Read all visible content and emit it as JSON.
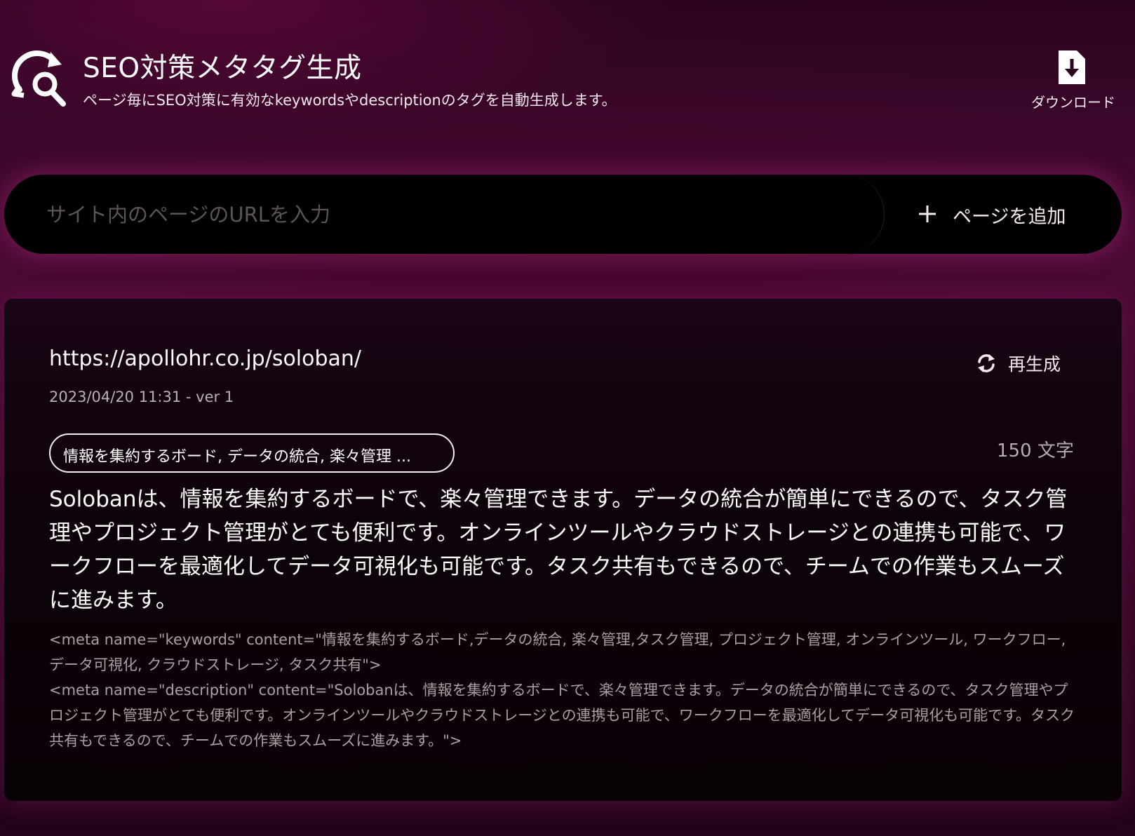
{
  "header": {
    "title": "SEO対策メタタグ生成",
    "subtitle": "ページ毎にSEO対策に有効なkeywordsやdescriptionのタグを自動生成します。",
    "logo_icon": "search-sync-icon",
    "download": {
      "label": "ダウンロード",
      "icon": "file-download-icon"
    }
  },
  "url_bar": {
    "placeholder": "サイト内のページのURLを入力",
    "value": "",
    "add_button": {
      "label": "ページを追加",
      "icon": "plus-icon"
    }
  },
  "card": {
    "url": "https://apollohr.co.jp/soloban/",
    "meta": "2023/04/20 11:31 - ver 1",
    "regenerate": {
      "label": "再生成",
      "icon": "refresh-icon"
    },
    "keywords_pill": "情報を集約するボード, データの統合, 楽々管理 ...",
    "char_count": "150 文字",
    "description": "Solobanは、情報を集約するボードで、楽々管理できます。データの統合が簡単にできるので、タスク管理やプロジェクト管理がとても便利です。オンラインツールやクラウドストレージとの連携も可能で、ワークフローを最適化してデータ可視化も可能です。タスク共有もできるので、チームでの作業もスムーズに進みます。",
    "meta_keywords_tag": "<meta name=\"keywords\" content=\"情報を集約するボード,データの統合, 楽々管理,タスク管理, プロジェクト管理, オンラインツール, ワークフロー, データ可視化, クラウドストレージ, タスク共有\">",
    "meta_description_tag": "<meta name=\"description\" content=\"Solobanは、情報を集約するボードで、楽々管理できます。データの統合が簡単にできるので、タスク管理やプロジェクト管理がとても便利です。オンラインツールやクラウドストレージとの連携も可能で、ワークフローを最適化してデータ可視化も可能です。タスク共有もできるので、チームでの作業もスムーズに進みます。\">"
  },
  "colors": {
    "background_top": "#2b0420",
    "background_mid": "#4a0a34",
    "url_bar": "#000000",
    "card": "#0d020a",
    "text_primary": "#ffffff",
    "text_muted": "#a8a0a5"
  }
}
